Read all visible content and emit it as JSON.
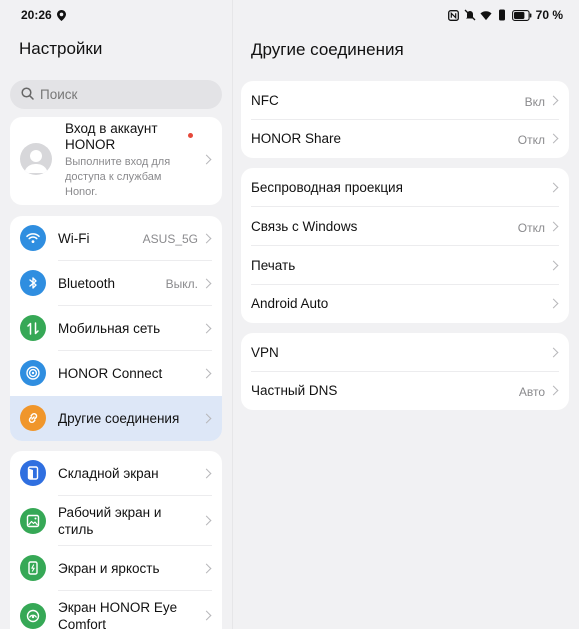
{
  "status": {
    "time": "20:26",
    "battery": "70 %"
  },
  "left": {
    "title": "Настройки",
    "search_placeholder": "Поиск",
    "account": {
      "title": "Вход в аккаунт HONOR",
      "subtitle": "Выполните вход для доступа к службам Honor."
    },
    "group1": [
      {
        "label": "Wi-Fi",
        "value": "ASUS_5G",
        "icon": "wifi-icon",
        "color": "#2f8ee0"
      },
      {
        "label": "Bluetooth",
        "value": "Выкл.",
        "icon": "bluetooth-icon",
        "color": "#2f8ee0"
      },
      {
        "label": "Мобильная сеть",
        "value": "",
        "icon": "mobile-network-icon",
        "color": "#36a856"
      },
      {
        "label": "HONOR Connect",
        "value": "",
        "icon": "honor-connect-icon",
        "color": "#2f8ee0"
      },
      {
        "label": "Другие соединения",
        "value": "",
        "icon": "link-icon",
        "color": "#f0962b"
      }
    ],
    "group2": [
      {
        "label": "Складной экран",
        "icon": "fold-screen-icon",
        "color": "#2f6fe0"
      },
      {
        "label": "Рабочий экран и стиль",
        "icon": "home-screen-icon",
        "color": "#36a856"
      },
      {
        "label": "Экран и яркость",
        "icon": "display-icon",
        "color": "#36a856"
      },
      {
        "label": "Экран HONOR Eye Comfort",
        "icon": "eye-comfort-icon",
        "color": "#36a856"
      }
    ]
  },
  "right": {
    "title": "Другие соединения",
    "group1": [
      {
        "label": "NFC",
        "value": "Вкл"
      },
      {
        "label": "HONOR Share",
        "value": "Откл"
      }
    ],
    "group2": [
      {
        "label": "Беспроводная проекция",
        "value": ""
      },
      {
        "label": "Связь с Windows",
        "value": "Откл"
      },
      {
        "label": "Печать",
        "value": ""
      },
      {
        "label": "Android Auto",
        "value": ""
      }
    ],
    "group3": [
      {
        "label": "VPN",
        "value": ""
      },
      {
        "label": "Частный DNS",
        "value": "Авто"
      }
    ]
  }
}
